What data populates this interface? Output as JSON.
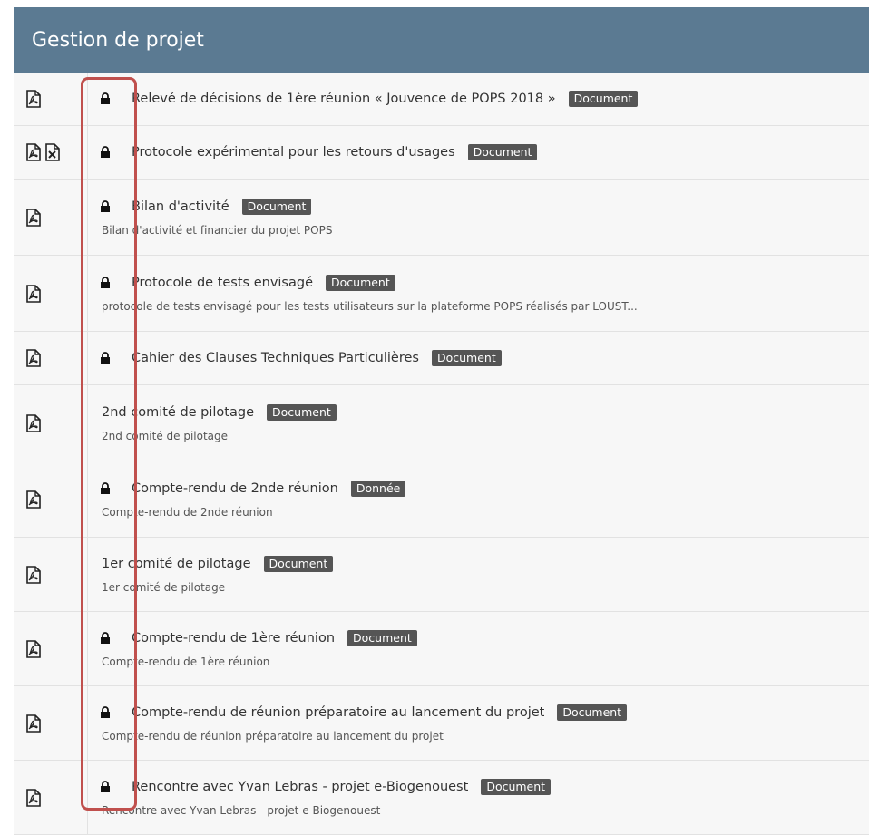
{
  "header": {
    "title": "Gestion de projet"
  },
  "items": [
    {
      "title": "Relevé de décisions de 1ère réunion « Jouvence de POPS 2018 »",
      "badge": "Document",
      "desc": "",
      "locked": true,
      "icons": [
        "pdf-icon"
      ]
    },
    {
      "title": "Protocole expérimental pour les retours d'usages",
      "badge": "Document",
      "desc": "",
      "locked": true,
      "icons": [
        "pdf-icon",
        "excel-icon"
      ]
    },
    {
      "title": "Bilan d'activité",
      "badge": "Document",
      "desc": "Bilan d'activité et financier du projet POPS",
      "locked": true,
      "icons": [
        "pdf-icon"
      ]
    },
    {
      "title": "Protocole de tests envisagé",
      "badge": "Document",
      "desc": "protocole de tests envisagé pour les tests utilisateurs sur la plateforme POPS réalisés par LOUST...",
      "locked": true,
      "icons": [
        "pdf-icon"
      ]
    },
    {
      "title": "Cahier des Clauses Techniques Particulières",
      "badge": "Document",
      "desc": "",
      "locked": true,
      "icons": [
        "pdf-icon"
      ]
    },
    {
      "title": "2nd comité de pilotage",
      "badge": "Document",
      "desc": "2nd comité de pilotage",
      "locked": false,
      "icons": [
        "pdf-icon"
      ]
    },
    {
      "title": "Compte-rendu de 2nde réunion",
      "badge": "Donnée",
      "desc": "Compte-rendu de 2nde réunion",
      "locked": true,
      "icons": [
        "pdf-icon"
      ]
    },
    {
      "title": "1er comité de pilotage",
      "badge": "Document",
      "desc": "1er comité de pilotage",
      "locked": false,
      "icons": [
        "pdf-icon"
      ]
    },
    {
      "title": "Compte-rendu de 1ère réunion",
      "badge": "Document",
      "desc": "Compte-rendu de 1ère réunion",
      "locked": true,
      "icons": [
        "pdf-icon"
      ]
    },
    {
      "title": "Compte-rendu de réunion préparatoire au lancement du projet",
      "badge": "Document",
      "desc": "Compte-rendu de réunion préparatoire au lancement du projet",
      "locked": true,
      "icons": [
        "pdf-icon"
      ]
    },
    {
      "title": "Rencontre avec Yvan Lebras - projet e-Biogenouest",
      "badge": "Document",
      "desc": "Rencontre avec Yvan Lebras - projet e-Biogenouest",
      "locked": true,
      "icons": [
        "pdf-icon"
      ]
    }
  ],
  "colors": {
    "header_bg": "#5b7a92",
    "badge_bg": "#555555",
    "highlight": "#c0504d"
  }
}
